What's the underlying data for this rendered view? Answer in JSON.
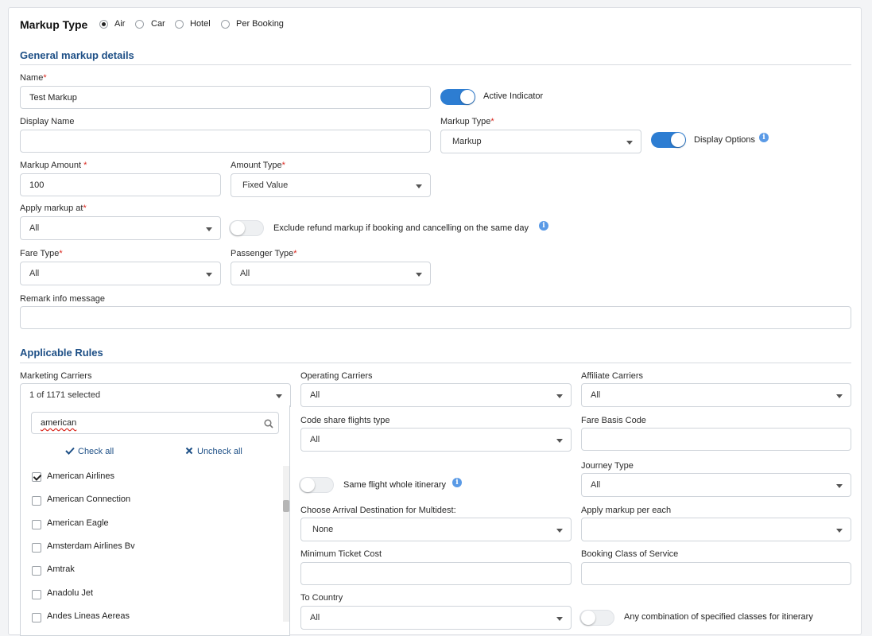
{
  "markup_type": {
    "label": "Markup Type",
    "options": [
      "Air",
      "Car",
      "Hotel",
      "Per Booking"
    ],
    "selected": "Air"
  },
  "general": {
    "title": "General markup details",
    "name_label": "Name",
    "name_value": "Test Markup",
    "active_indicator_label": "Active Indicator",
    "display_name_label": "Display Name",
    "display_name_value": "",
    "markup_type_label": "Markup Type",
    "markup_type_value": "Markup",
    "display_options_label": "Display Options",
    "markup_amount_label": "Markup Amount ",
    "markup_amount_value": "100",
    "amount_type_label": "Amount Type",
    "amount_type_value": "Fixed Value",
    "apply_markup_at_label": "Apply markup at",
    "apply_markup_at_value": "All",
    "exclude_refund_label": "Exclude refund markup if booking and cancelling on the same day",
    "fare_type_label": "Fare Type",
    "fare_type_value": "All",
    "passenger_type_label": "Passenger Type",
    "passenger_type_value": "All",
    "remark_label": "Remark info message",
    "remark_value": "",
    "required_mark": "*"
  },
  "rules": {
    "title": "Applicable Rules",
    "marketing_carriers_label": "Marketing Carriers",
    "marketing_carriers_value": "1 of 1171 selected",
    "search_value": "american",
    "check_all": "Check all",
    "uncheck_all": "Uncheck all",
    "carriers": [
      {
        "label": "American Airlines",
        "checked": true
      },
      {
        "label": "American Connection",
        "checked": false
      },
      {
        "label": "American Eagle",
        "checked": false
      },
      {
        "label": "Amsterdam Airlines Bv",
        "checked": false
      },
      {
        "label": "Amtrak",
        "checked": false
      },
      {
        "label": "Anadolu Jet",
        "checked": false
      },
      {
        "label": "Andes Lineas Aereas",
        "checked": false
      }
    ],
    "operating_carriers_label": "Operating Carriers",
    "operating_carriers_value": "All",
    "affiliate_carriers_label": "Affiliate Carriers",
    "affiliate_carriers_value": "All",
    "code_share_label": "Code share flights type",
    "code_share_value": "All",
    "fare_basis_label": "Fare Basis Code",
    "fare_basis_value": "",
    "journey_type_label": "Journey Type",
    "journey_type_value": "All",
    "same_flight_label": "Same flight whole itinerary",
    "arrival_dest_label": "Choose Arrival Destination for Multidest:",
    "arrival_dest_value": "None",
    "apply_per_each_label": "Apply markup per each",
    "apply_per_each_value": "",
    "min_ticket_label": "Minimum Ticket Cost",
    "min_ticket_value": "",
    "booking_class_label": "Booking Class of Service",
    "booking_class_value": "",
    "to_country_label": "To Country",
    "to_country_value": "All",
    "any_combination_label": "Any combination of specified classes for itinerary"
  },
  "colors": {
    "accent": "#2d7dd2",
    "section_title": "#1d4f86",
    "required": "#d9251c"
  },
  "info_glyph": "i"
}
